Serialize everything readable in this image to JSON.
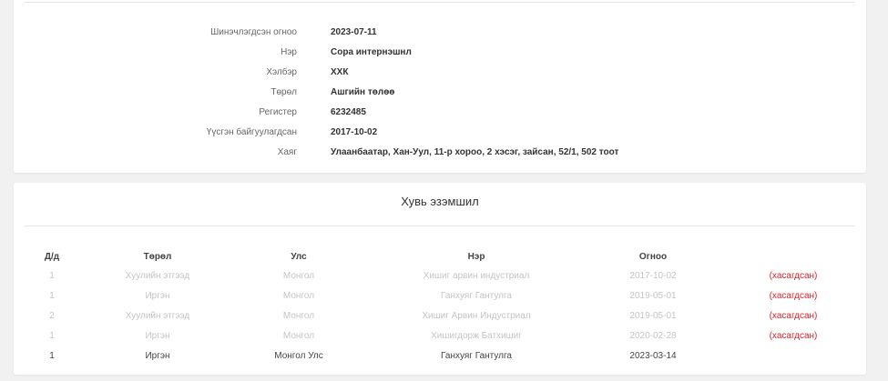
{
  "info": {
    "rows": [
      {
        "label": "Шинэчлэгдсэн огноо",
        "value": "2023-07-11"
      },
      {
        "label": "Нэр",
        "value": "Сора интернэшнл"
      },
      {
        "label": "Хэлбэр",
        "value": "ХХК"
      },
      {
        "label": "Төрөл",
        "value": "Ашгийн төлөө"
      },
      {
        "label": "Регистер",
        "value": "6232485"
      },
      {
        "label": "Үүсгэн байгуулагдсан",
        "value": "2017-10-02"
      },
      {
        "label": "Хаяг",
        "value": "Улаанбаатар, Хан-Уул, 11-р хороо, 2 хэсэг, зайсан, 52/1, 502 тоот"
      }
    ]
  },
  "owners": {
    "title": "Хувь эзэмшил",
    "headers": {
      "no": "Д/д",
      "type": "Төрөл",
      "country": "Улс",
      "name": "Нэр",
      "date": "Огноо"
    },
    "rows": [
      {
        "no": "1",
        "type": "Хуулийн этгээд",
        "country": "Монгол",
        "name": "Хишиг арвин индустриал",
        "date": "2017-10-02",
        "status": "(хасагдсан)"
      },
      {
        "no": "1",
        "type": "Иргэн",
        "country": "Монгол",
        "name": "Ганхуяг Гантулга",
        "date": "2019-05-01",
        "status": "(хасагдсан)"
      },
      {
        "no": "2",
        "type": "Хуулийн этгээд",
        "country": "Монгол",
        "name": "Хишиг Арвин Индустриал",
        "date": "2019-05-01",
        "status": "(хасагдсан)"
      },
      {
        "no": "1",
        "type": "Иргэн",
        "country": "Монгол",
        "name": "Хишигдорж Батхишиг",
        "date": "2020-02-28",
        "status": "(хасагдсан)"
      },
      {
        "no": "1",
        "type": "Иргэн",
        "country": "Монгол Улс",
        "name": "Ганхуяг Гантулга",
        "date": "2023-03-14",
        "status": ""
      }
    ]
  },
  "colors": {
    "removed": "#d9232a",
    "inactive_text": "#c4c4c4",
    "background": "#f1f1f1"
  }
}
